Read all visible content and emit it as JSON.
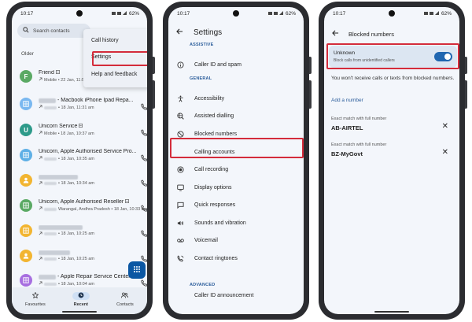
{
  "status": {
    "time": "10:17",
    "battery": "62%"
  },
  "phone1": {
    "search_placeholder": "Search contacts",
    "menu": [
      "Call history",
      "Settings",
      "Help and feedback"
    ],
    "section": "Older",
    "calls": [
      {
        "initial": "F",
        "name": "Friend",
        "detail": "Mobile • 22 Jan, 11:5",
        "avatar_color": "#5aa964",
        "icon": "person-initial"
      },
      {
        "initial": "",
        "name": "- Macbook iPhone Ipad Repa...",
        "detail": "• 18 Jan, 11:31 am",
        "avatar_color": "#7ab8f0",
        "icon": "business-icon"
      },
      {
        "initial": "U",
        "name": "Unicorn Service",
        "detail": "Mobile • 18 Jan, 10:37 am",
        "avatar_color": "#2d9a8a",
        "icon": "person-initial"
      },
      {
        "initial": "",
        "name": "Unicorn, Apple Authorised Service Pro...",
        "detail": "• 18 Jan, 10:35 am",
        "avatar_color": "#5fb0e6",
        "icon": "business-icon"
      },
      {
        "initial": "",
        "name": "",
        "detail": "• 18 Jan, 10:34 am",
        "avatar_color": "#f2b531",
        "icon": "person-icon"
      },
      {
        "initial": "",
        "name": "Unicorn, Apple Authorised Reseller",
        "detail": "Warangal, Andhra Pradesh • 18 Jan, 10:33 am",
        "avatar_color": "#5aa964",
        "icon": "business-icon"
      },
      {
        "initial": "",
        "name": "",
        "detail": "• 18 Jan, 10:25 am",
        "avatar_color": "#f2b531",
        "icon": "business-icon"
      },
      {
        "initial": "",
        "name": "",
        "detail": "• 18 Jan, 10:25 am",
        "avatar_color": "#f2b531",
        "icon": "person-icon"
      },
      {
        "initial": "",
        "name": "- Apple Repair Service Center",
        "detail": "• 18 Jan, 10:04 am",
        "avatar_color": "#a76fe0",
        "icon": "business-icon"
      }
    ],
    "nav": [
      "Favourites",
      "Recent",
      "Contacts"
    ]
  },
  "phone2": {
    "title": "Settings",
    "sections": [
      {
        "header": "ASSISTIVE",
        "items": [
          {
            "label": "Caller ID and spam",
            "icon": "info-icon"
          }
        ]
      },
      {
        "header": "GENERAL",
        "items": [
          {
            "label": "Accessibility",
            "icon": "accessibility-icon"
          },
          {
            "label": "Assisted dialling",
            "icon": "globe-search-icon"
          },
          {
            "label": "Blocked numbers",
            "icon": "block-icon"
          },
          {
            "label": "Calling accounts",
            "icon": "blank"
          },
          {
            "label": "Call recording",
            "icon": "record-icon"
          },
          {
            "label": "Display options",
            "icon": "display-icon"
          },
          {
            "label": "Quick responses",
            "icon": "message-icon"
          },
          {
            "label": "Sounds and vibration",
            "icon": "sound-icon"
          },
          {
            "label": "Voicemail",
            "icon": "voicemail-icon"
          },
          {
            "label": "Contact ringtones",
            "icon": "ringtone-icon"
          }
        ]
      },
      {
        "header": "ADVANCED",
        "items": [
          {
            "label": "Caller ID announcement",
            "icon": "blank"
          }
        ]
      }
    ]
  },
  "phone3": {
    "title": "Blocked numbers",
    "unknown_title": "Unknown",
    "unknown_sub": "Block calls from unidentified callers",
    "toggle_on": true,
    "info": "You won't receive calls or texts from blocked numbers.",
    "add": "Add a number",
    "blocked": [
      {
        "label": "Exact match with full number",
        "number": "AB-AIRTEL"
      },
      {
        "label": "Exact match with full number",
        "number": "BZ-MyGovt"
      }
    ]
  },
  "colors": {
    "accent": "#2066b0",
    "highlight": "#d42c3b",
    "fab": "#0b57a3"
  }
}
